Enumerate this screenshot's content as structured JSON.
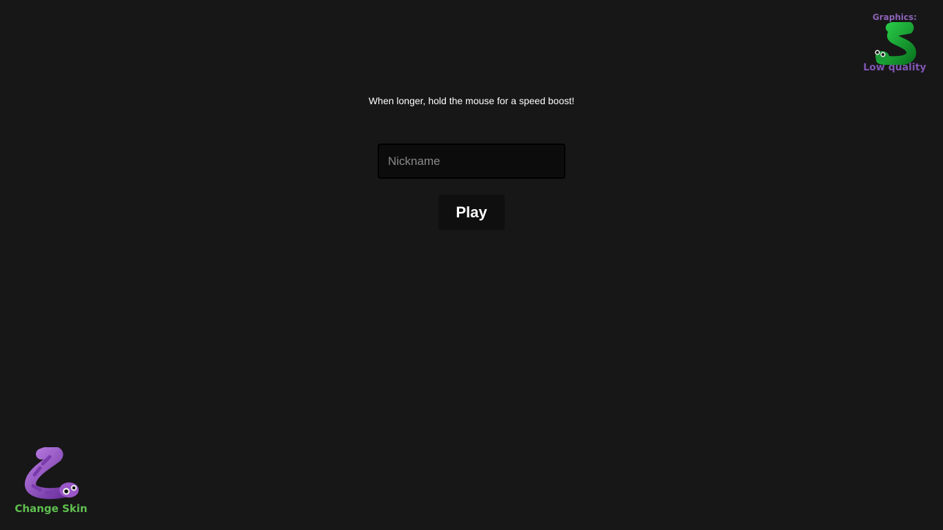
{
  "tip": "When longer, hold the mouse for a speed boost!",
  "nickname": {
    "value": "",
    "placeholder": "Nickname"
  },
  "play_label": "Play",
  "graphics": {
    "title": "Graphics:",
    "quality": "Low quality",
    "icon": "green-snake-icon"
  },
  "skin": {
    "label": "Change Skin",
    "icon": "purple-snake-icon"
  },
  "colors": {
    "background": "#171717",
    "text": "#ffffff",
    "graphics_label": "#8d63b8",
    "skin_label": "#5fbf4f",
    "snake_green": "#1fa63a",
    "snake_purple": "#9a56c8"
  }
}
